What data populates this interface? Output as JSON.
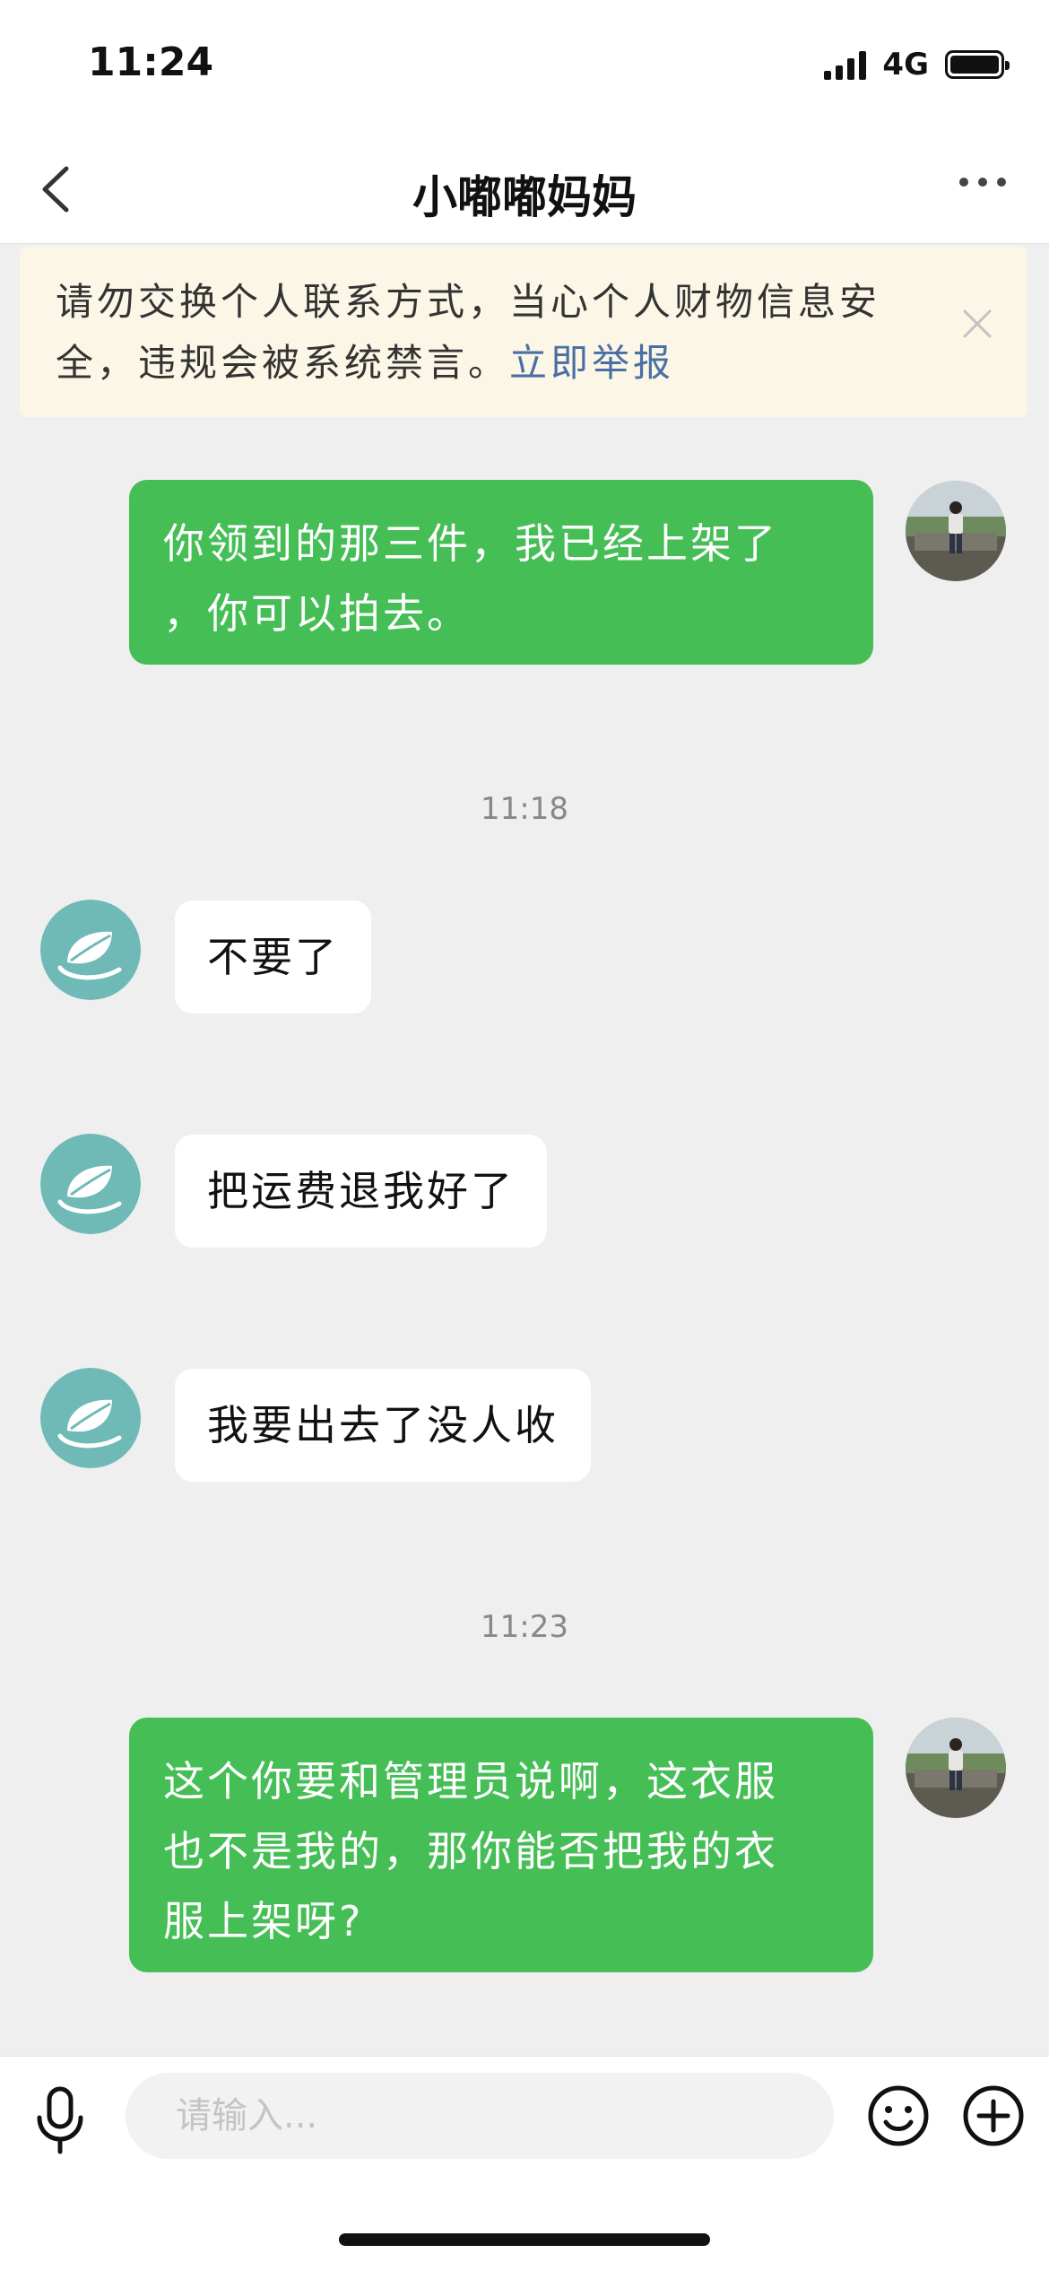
{
  "status_bar": {
    "time": "11:24",
    "network": "4G"
  },
  "header": {
    "title": "小嘟嘟妈妈"
  },
  "notice": {
    "text": "请勿交换个人联系方式，当心个人财物信息安全，违规会被系统禁言。",
    "link": "立即举报"
  },
  "messages": [
    {
      "side": "sent",
      "lines": [
        "你领到的那三件，我已经上架了",
        "，你可以拍去。"
      ]
    },
    {
      "timestamp": "11:18"
    },
    {
      "side": "recv",
      "text": "不要了"
    },
    {
      "side": "recv",
      "text": "把运费退我好了"
    },
    {
      "side": "recv",
      "text": "我要出去了没人收"
    },
    {
      "timestamp": "11:23"
    },
    {
      "side": "sent",
      "lines": [
        "这个你要和管理员说啊，这衣服",
        "也不是我的，那你能否把我的衣",
        "服上架呀?"
      ]
    }
  ],
  "composer": {
    "placeholder": "请输入..."
  },
  "colors": {
    "sent_bubble": "#45be56",
    "avatar_teal": "#6fb9b6",
    "link": "#4a6fa5"
  },
  "icons": [
    "back-icon",
    "more-icon",
    "close-icon",
    "microphone-icon",
    "emoji-icon",
    "plus-icon"
  ]
}
